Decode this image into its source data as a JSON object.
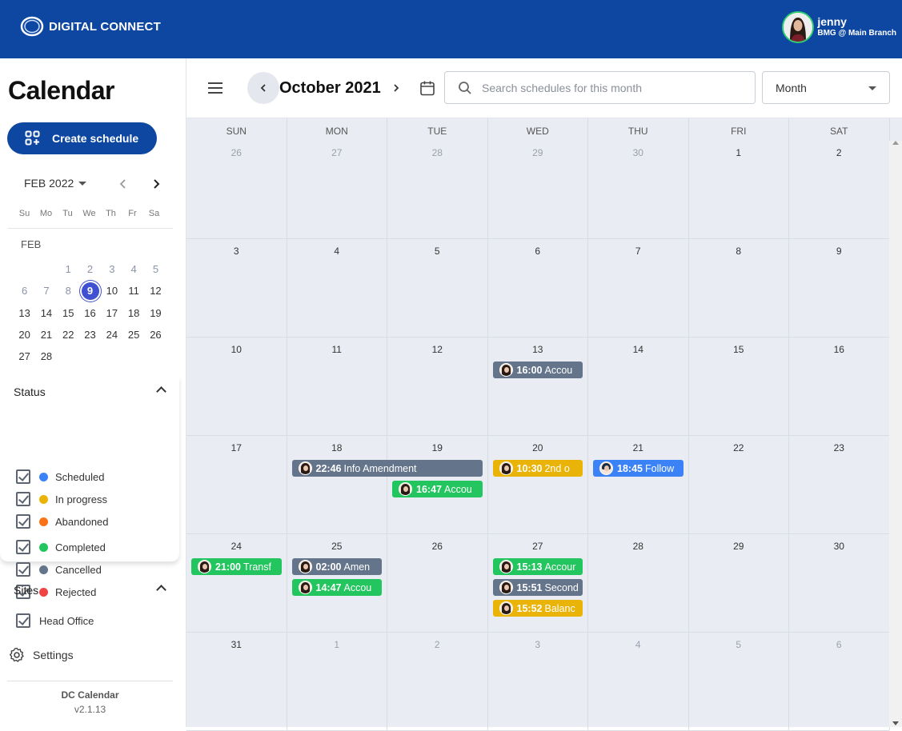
{
  "header": {
    "brand": "DIGITAL CONNECT",
    "user_name": "jenny",
    "user_branch": "BMG @ Main Branch"
  },
  "sidebar": {
    "title": "Calendar",
    "create_label": "Create schedule",
    "mini_calendar": {
      "month_label": "FEB 2022",
      "weekdays": [
        "Su",
        "Mo",
        "Tu",
        "We",
        "Th",
        "Fr",
        "Sa"
      ],
      "section_label": "FEB",
      "days": [
        {
          "d": "",
          "c": ""
        },
        {
          "d": "",
          "c": ""
        },
        {
          "d": "1",
          "c": "dim"
        },
        {
          "d": "2",
          "c": "dim"
        },
        {
          "d": "3",
          "c": "dim"
        },
        {
          "d": "4",
          "c": "dim"
        },
        {
          "d": "5",
          "c": "dim"
        },
        {
          "d": "6",
          "c": "dim"
        },
        {
          "d": "7",
          "c": "dim"
        },
        {
          "d": "8",
          "c": "dim"
        },
        {
          "d": "9",
          "c": "sel"
        },
        {
          "d": "10",
          "c": ""
        },
        {
          "d": "11",
          "c": ""
        },
        {
          "d": "12",
          "c": ""
        },
        {
          "d": "13",
          "c": ""
        },
        {
          "d": "14",
          "c": ""
        },
        {
          "d": "15",
          "c": ""
        },
        {
          "d": "16",
          "c": ""
        },
        {
          "d": "17",
          "c": ""
        },
        {
          "d": "18",
          "c": ""
        },
        {
          "d": "19",
          "c": ""
        },
        {
          "d": "20",
          "c": ""
        },
        {
          "d": "21",
          "c": ""
        },
        {
          "d": "22",
          "c": ""
        },
        {
          "d": "23",
          "c": ""
        },
        {
          "d": "24",
          "c": ""
        },
        {
          "d": "25",
          "c": ""
        },
        {
          "d": "26",
          "c": ""
        },
        {
          "d": "27",
          "c": ""
        },
        {
          "d": "28",
          "c": ""
        }
      ]
    },
    "status_title": "Status",
    "statuses": [
      {
        "label": "Scheduled",
        "color": "#3b82f6"
      },
      {
        "label": "In progress",
        "color": "#eab308"
      },
      {
        "label": "Abandoned",
        "color": "#f97316"
      },
      {
        "label": "Completed",
        "color": "#22c55e"
      },
      {
        "label": "Cancelled",
        "color": "#64748b"
      },
      {
        "label": "Rejected",
        "color": "#ef4444"
      }
    ],
    "sites_title": "Sites",
    "sites": [
      {
        "label": "Head Office"
      }
    ],
    "settings_label": "Settings",
    "footer_name": "DC Calendar",
    "footer_version": "v2.1.13"
  },
  "toolbar": {
    "month_title": "October 2021",
    "search_placeholder": "Search schedules for this month",
    "view_label": "Month"
  },
  "calendar": {
    "weekdays": [
      "SUN",
      "MON",
      "TUE",
      "WED",
      "THU",
      "FRI",
      "SAT"
    ],
    "weeks": [
      [
        {
          "n": "26",
          "out": true
        },
        {
          "n": "27",
          "out": true
        },
        {
          "n": "28",
          "out": true
        },
        {
          "n": "29",
          "out": true
        },
        {
          "n": "30",
          "out": true
        },
        {
          "n": "1",
          "out": false
        },
        {
          "n": "2",
          "out": false
        }
      ],
      [
        {
          "n": "3",
          "out": false
        },
        {
          "n": "4",
          "out": false
        },
        {
          "n": "5",
          "out": false
        },
        {
          "n": "6",
          "out": false
        },
        {
          "n": "7",
          "out": false
        },
        {
          "n": "8",
          "out": false
        },
        {
          "n": "9",
          "out": false
        }
      ],
      [
        {
          "n": "10",
          "out": false
        },
        {
          "n": "11",
          "out": false
        },
        {
          "n": "12",
          "out": false
        },
        {
          "n": "13",
          "out": false
        },
        {
          "n": "14",
          "out": false
        },
        {
          "n": "15",
          "out": false
        },
        {
          "n": "16",
          "out": false
        }
      ],
      [
        {
          "n": "17",
          "out": false
        },
        {
          "n": "18",
          "out": false
        },
        {
          "n": "19",
          "out": false
        },
        {
          "n": "20",
          "out": false
        },
        {
          "n": "21",
          "out": false
        },
        {
          "n": "22",
          "out": false
        },
        {
          "n": "23",
          "out": false
        }
      ],
      [
        {
          "n": "24",
          "out": false
        },
        {
          "n": "25",
          "out": false
        },
        {
          "n": "26",
          "out": false
        },
        {
          "n": "27",
          "out": false
        },
        {
          "n": "28",
          "out": false
        },
        {
          "n": "29",
          "out": false
        },
        {
          "n": "30",
          "out": false
        }
      ],
      [
        {
          "n": "31",
          "out": false
        },
        {
          "n": "1",
          "out": true
        },
        {
          "n": "2",
          "out": true
        },
        {
          "n": "3",
          "out": true
        },
        {
          "n": "4",
          "out": true
        },
        {
          "n": "5",
          "out": true
        },
        {
          "n": "6",
          "out": true
        }
      ]
    ],
    "events": [
      {
        "week": 2,
        "day": 3,
        "span": 1,
        "slot": 0,
        "time": "16:00",
        "title": "Accou",
        "color": "#64748b",
        "avatar": "girl"
      },
      {
        "week": 3,
        "day": 1,
        "span": 2,
        "slot": 0,
        "time": "22:46",
        "title": "Info Amendment",
        "color": "#64748b",
        "avatar": "girl"
      },
      {
        "week": 3,
        "day": 2,
        "span": 1,
        "slot": 1,
        "time": "16:47",
        "title": "Accou",
        "color": "#22c55e",
        "avatar": "girl"
      },
      {
        "week": 3,
        "day": 3,
        "span": 1,
        "slot": 0,
        "time": "10:30",
        "title": "2nd o",
        "color": "#eab308",
        "avatar": "girl"
      },
      {
        "week": 3,
        "day": 4,
        "span": 1,
        "slot": 0,
        "time": "18:45",
        "title": "Follow",
        "color": "#3b82f6",
        "avatar": "boy"
      },
      {
        "week": 4,
        "day": 0,
        "span": 1,
        "slot": 0,
        "time": "21:00",
        "title": "Transf",
        "color": "#22c55e",
        "avatar": "girl"
      },
      {
        "week": 4,
        "day": 1,
        "span": 1,
        "slot": 0,
        "time": "02:00",
        "title": "Amen",
        "color": "#64748b",
        "avatar": "girl"
      },
      {
        "week": 4,
        "day": 1,
        "span": 1,
        "slot": 1,
        "time": "14:47",
        "title": "Accou",
        "color": "#22c55e",
        "avatar": "girl"
      },
      {
        "week": 4,
        "day": 3,
        "span": 1,
        "slot": 0,
        "time": "15:13",
        "title": "Accour",
        "color": "#22c55e",
        "avatar": "girl"
      },
      {
        "week": 4,
        "day": 3,
        "span": 1,
        "slot": 1,
        "time": "15:51",
        "title": "Second",
        "color": "#64748b",
        "avatar": "girl"
      },
      {
        "week": 4,
        "day": 3,
        "span": 1,
        "slot": 2,
        "time": "15:52",
        "title": "Balanc",
        "color": "#eab308",
        "avatar": "girl"
      }
    ]
  }
}
